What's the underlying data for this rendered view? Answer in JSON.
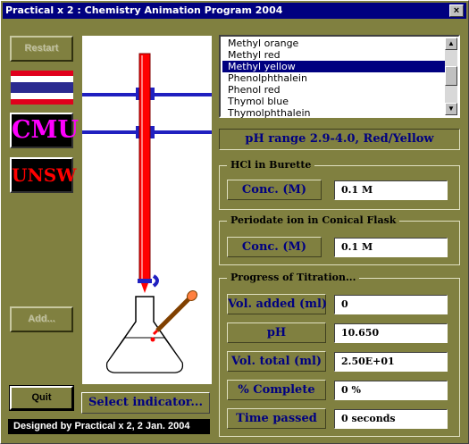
{
  "window": {
    "title": "Practical x 2 : Chemistry Animation Program 2004",
    "close_glyph": "×"
  },
  "left": {
    "restart_label": "Restart",
    "cmu_label": "CMU",
    "unsw_label": "UNSW",
    "add_label": "Add...",
    "quit_label": "Quit",
    "footer": "Designed by Practical x 2, 2 Jan. 2004"
  },
  "sim": {
    "select_indicator_label": "Select indicator..."
  },
  "indicators": {
    "items": [
      "Methyl orange",
      "Methyl red",
      "Methyl yellow",
      "Phenolphthalein",
      "Phenol red",
      "Thymol blue",
      "Thymolphthalein"
    ],
    "selected": "Methyl yellow"
  },
  "ph_range": "pH range 2.9-4.0, Red/Yellow",
  "burette_group": {
    "title": "HCl in Burette",
    "conc_label": "Conc. (M)",
    "conc_value": "0.1 M"
  },
  "flask_group": {
    "title": "Periodate ion in Conical Flask",
    "conc_label": "Conc. (M)",
    "conc_value": "0.1 M"
  },
  "progress_group": {
    "title": "Progress of Titration...",
    "vol_added_label": "Vol. added (ml)",
    "vol_added_value": "0",
    "ph_label": "pH",
    "ph_value": "10.650",
    "vol_total_label": "Vol. total (ml)",
    "vol_total_value": "2.50E+01",
    "complete_label": "% Complete",
    "complete_value": "0 %",
    "time_label": "Time passed",
    "time_value": "0 seconds"
  },
  "colors": {
    "panel": "#808040",
    "title_bar": "#000080",
    "label_text": "#000080",
    "burette_liquid": "#ff0000",
    "selection": "#000080"
  },
  "icons": [
    "thai-flag-icon",
    "close-icon",
    "scroll-up-icon",
    "scroll-down-icon"
  ]
}
